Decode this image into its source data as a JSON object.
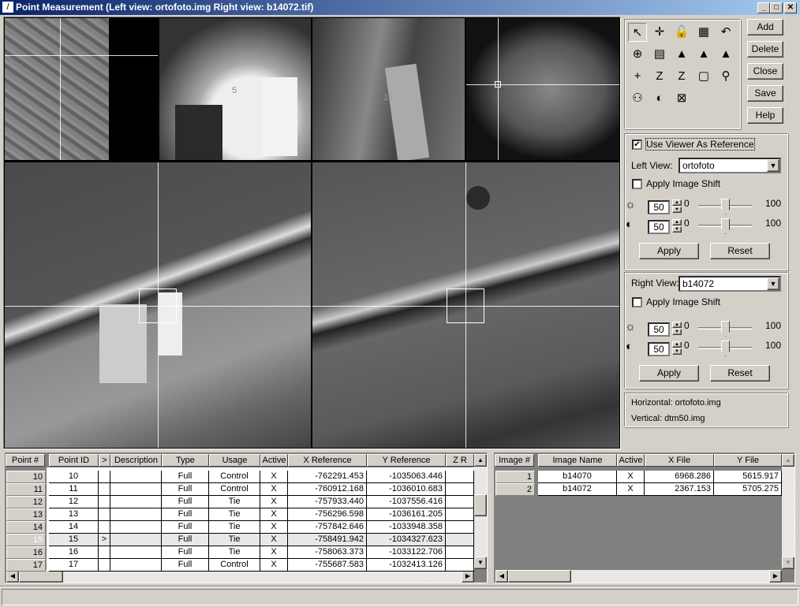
{
  "window": {
    "title": "Point Measurement (Left view: ortofoto.img  Right view: b14072.tif)",
    "minimize": "_",
    "maximize": "□",
    "close": "✕"
  },
  "views": {
    "top_labels": [
      {
        "num": "5"
      },
      {
        "num": "15"
      }
    ]
  },
  "toolbar": {
    "icons": [
      "select-arrow-icon",
      "crosshair-icon",
      "lock-icon",
      "layout-icon",
      "undo-icon",
      "auto-drive-icon",
      "create-point-icon",
      "triangle-icon",
      "triangle-image-icon",
      "triangle-page-icon",
      "add-point-icon",
      "z-icon",
      "z-box-icon",
      "box-icon",
      "link-icon",
      "viewer-link-icon",
      "view-swap-icon",
      "zoom-box-icon"
    ],
    "glyphs": [
      "↖",
      "✛",
      "🔓",
      "▦",
      "↶",
      "⊕",
      "▤",
      "▲",
      "▲",
      "▲",
      "+",
      "Z",
      "Z",
      "▢",
      "⚲",
      "⚇",
      "◐",
      "⊠"
    ]
  },
  "buttons": {
    "add": "Add",
    "delete": "Delete",
    "close": "Close",
    "save": "Save",
    "help": "Help"
  },
  "left_panel": {
    "use_viewer_ref": "Use Viewer As Reference",
    "use_viewer_ref_checked": true,
    "left_view_label": "Left View:",
    "left_view_value": "ortofoto",
    "apply_shift": "Apply Image Shift",
    "apply_shift_checked": false,
    "brightness": "50",
    "contrast": "50",
    "min": "0",
    "max": "100",
    "brightness_level": 50,
    "contrast_level": 50,
    "apply": "Apply",
    "reset": "Reset"
  },
  "right_panel": {
    "right_view_label": "Right View:",
    "right_view_value": "b14072",
    "apply_shift": "Apply Image Shift",
    "apply_shift_checked": false,
    "brightness": "50",
    "contrast": "50",
    "min": "0",
    "max": "100",
    "brightness_level": 50,
    "contrast_level": 50,
    "apply": "Apply",
    "reset": "Reset"
  },
  "info": {
    "horizontal": "Horizontal: ortofoto.img",
    "vertical": "Vertical: dtm50.img"
  },
  "points_table": {
    "columns": [
      "Point #",
      "Point ID",
      ">",
      "Description",
      "Type",
      "Usage",
      "Active",
      "X Reference",
      "Y Reference",
      "Z R"
    ],
    "rows": [
      {
        "num": "10",
        "id": "10",
        "cur": "",
        "desc": "",
        "type": "Full",
        "usage": "Control",
        "active": "X",
        "x": "-762291.453",
        "y": "-1035063.446"
      },
      {
        "num": "11",
        "id": "11",
        "cur": "",
        "desc": "",
        "type": "Full",
        "usage": "Control",
        "active": "X",
        "x": "-760912.168",
        "y": "-1036010.683"
      },
      {
        "num": "12",
        "id": "12",
        "cur": "",
        "desc": "",
        "type": "Full",
        "usage": "Tie",
        "active": "X",
        "x": "-757933.440",
        "y": "-1037556.416"
      },
      {
        "num": "13",
        "id": "13",
        "cur": "",
        "desc": "",
        "type": "Full",
        "usage": "Tie",
        "active": "X",
        "x": "-756296.598",
        "y": "-1036161.205"
      },
      {
        "num": "14",
        "id": "14",
        "cur": "",
        "desc": "",
        "type": "Full",
        "usage": "Tie",
        "active": "X",
        "x": "-757842.646",
        "y": "-1033948.358"
      },
      {
        "num": "15",
        "id": "15",
        "cur": ">",
        "desc": "",
        "type": "Full",
        "usage": "Tie",
        "active": "X",
        "x": "-758491.942",
        "y": "-1034327.623"
      },
      {
        "num": "16",
        "id": "16",
        "cur": "",
        "desc": "",
        "type": "Full",
        "usage": "Tie",
        "active": "X",
        "x": "-758063.373",
        "y": "-1033122.706"
      },
      {
        "num": "17",
        "id": "17",
        "cur": "",
        "desc": "",
        "type": "Full",
        "usage": "Control",
        "active": "X",
        "x": "-755687.583",
        "y": "-1032413.126"
      }
    ],
    "selected": "15"
  },
  "images_table": {
    "columns": [
      "Image #",
      "Image Name",
      "Active",
      "X File",
      "Y File"
    ],
    "rows": [
      {
        "num": "1",
        "name": "b14070",
        "active": "X",
        "x": "6968.286",
        "y": "5615.917"
      },
      {
        "num": "2",
        "name": "b14072",
        "active": "X",
        "x": "2367.153",
        "y": "5705.275"
      }
    ]
  }
}
